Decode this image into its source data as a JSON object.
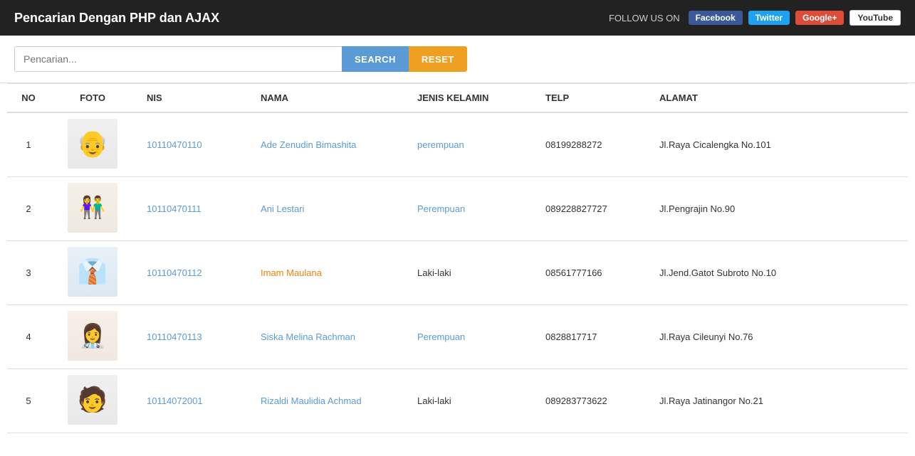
{
  "header": {
    "title": "Pencarian Dengan PHP dan AJAX",
    "follow_label": "FOLLOW US ON",
    "social_buttons": [
      {
        "id": "facebook",
        "label": "Facebook",
        "class": "facebook"
      },
      {
        "id": "twitter",
        "label": "Twitter",
        "class": "twitter"
      },
      {
        "id": "google-plus",
        "label": "Google+",
        "class": "google-plus"
      },
      {
        "id": "youtube",
        "label": "YouTube",
        "class": "youtube"
      }
    ]
  },
  "search": {
    "placeholder": "Pencarian...",
    "search_label": "SEARCH",
    "reset_label": "RESET"
  },
  "table": {
    "columns": [
      {
        "id": "no",
        "label": "NO"
      },
      {
        "id": "foto",
        "label": "FOTO"
      },
      {
        "id": "nis",
        "label": "NIS"
      },
      {
        "id": "nama",
        "label": "NAMA"
      },
      {
        "id": "jenis_kelamin",
        "label": "JENIS KELAMIN"
      },
      {
        "id": "telp",
        "label": "TELP"
      },
      {
        "id": "alamat",
        "label": "ALAMAT"
      }
    ],
    "rows": [
      {
        "no": 1,
        "avatar_class": "avatar-1",
        "nis": "10110470110",
        "nama": "Ade Zenudin Bimashita",
        "nama_style": "blue",
        "jenis_kelamin": "perempuan",
        "jk_style": "perempuan",
        "telp": "08199288272",
        "alamat": "Jl.Raya Cicalengka No.101"
      },
      {
        "no": 2,
        "avatar_class": "avatar-2",
        "nis": "10110470111",
        "nama": "Ani Lestari",
        "nama_style": "blue",
        "jenis_kelamin": "Perempuan",
        "jk_style": "perempuan",
        "telp": "089228827727",
        "alamat": "Jl.Pengrajin No.90"
      },
      {
        "no": 3,
        "avatar_class": "avatar-3",
        "nis": "10110470112",
        "nama": "Imam Maulana",
        "nama_style": "orange",
        "jenis_kelamin": "Laki-laki",
        "jk_style": "lakilaki",
        "telp": "08561777166",
        "alamat": "Jl.Jend.Gatot Subroto No.10"
      },
      {
        "no": 4,
        "avatar_class": "avatar-4",
        "nis": "10110470113",
        "nama": "Siska Melina Rachman",
        "nama_style": "blue",
        "jenis_kelamin": "Perempuan",
        "jk_style": "perempuan",
        "telp": "0828817717",
        "alamat": "Jl.Raya Cileunyi No.76"
      },
      {
        "no": 5,
        "avatar_class": "avatar-5",
        "nis": "10114072001",
        "nama": "Rizaldi Maulidia Achmad",
        "nama_style": "blue",
        "jenis_kelamin": "Laki-laki",
        "jk_style": "lakilaki",
        "telp": "089283773622",
        "alamat": "Jl.Raya Jatinangor No.21"
      }
    ]
  }
}
